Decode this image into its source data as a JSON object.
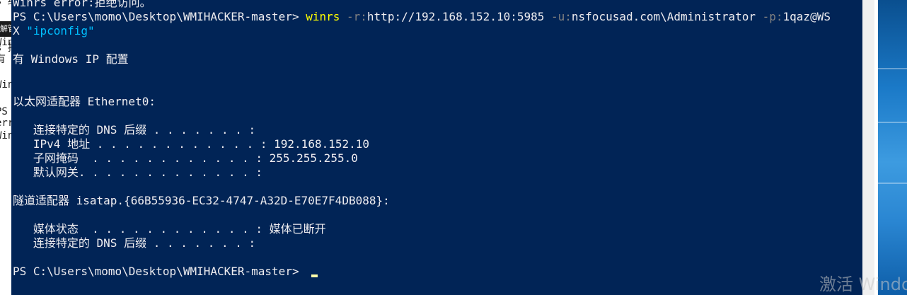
{
  "background_window": {
    "fragments": [
      "s 终",
      "Win",
      "s 拒",
      "有",
      "Win",
      "PS F",
      "err",
      "Win"
    ],
    "dark_tab_label": "解管"
  },
  "console": {
    "lines": [
      [
        {
          "t": "Winrs error:拒绝访问。",
          "c": ""
        }
      ],
      [
        {
          "t": "PS C:\\Users\\momo\\Desktop\\WMIHACKER-master> ",
          "c": ""
        },
        {
          "t": "winrs",
          "c": "cmd"
        },
        {
          "t": " -r:",
          "c": "param"
        },
        {
          "t": "http://192.168.152.10:5985",
          "c": ""
        },
        {
          "t": " -u:",
          "c": "param"
        },
        {
          "t": "nsfocusad.com\\Administrator",
          "c": ""
        },
        {
          "t": " -p:",
          "c": "param"
        },
        {
          "t": "1qaz@WS",
          "c": ""
        }
      ],
      [
        {
          "t": "X ",
          "c": ""
        },
        {
          "t": "\"ipconfig\"",
          "c": "str"
        }
      ],
      [
        {
          "t": "",
          "c": ""
        }
      ],
      [
        {
          "t": "有 Windows IP 配置",
          "c": ""
        }
      ],
      [
        {
          "t": "",
          "c": ""
        }
      ],
      [
        {
          "t": "",
          "c": ""
        }
      ],
      [
        {
          "t": "以太网适配器 Ethernet0:",
          "c": ""
        }
      ],
      [
        {
          "t": "",
          "c": ""
        }
      ],
      [
        {
          "t": "   连接特定的 DNS 后缀 . . . . . . . :",
          "c": ""
        }
      ],
      [
        {
          "t": "   IPv4 地址 . . . . . . . . . . . . : 192.168.152.10",
          "c": ""
        }
      ],
      [
        {
          "t": "   子网掩码  . . . . . . . . . . . . : 255.255.255.0",
          "c": ""
        }
      ],
      [
        {
          "t": "   默认网关. . . . . . . . . . . . . :",
          "c": ""
        }
      ],
      [
        {
          "t": "",
          "c": ""
        }
      ],
      [
        {
          "t": "隧道适配器 isatap.{66B55936-EC32-4747-A32D-E70E7F4DB088}:",
          "c": ""
        }
      ],
      [
        {
          "t": "",
          "c": ""
        }
      ],
      [
        {
          "t": "   媒体状态  . . . . . . . . . . . . : 媒体已断开",
          "c": ""
        }
      ],
      [
        {
          "t": "   连接特定的 DNS 后缀 . . . . . . . :",
          "c": ""
        }
      ],
      [
        {
          "t": "",
          "c": ""
        }
      ],
      [
        {
          "t": "PS C:\\Users\\momo\\Desktop\\WMIHACKER-master> ",
          "c": ""
        }
      ]
    ],
    "colors": {
      "background": "#012456",
      "foreground": "#eeedf0",
      "command": "#ffff00",
      "parameter": "#808080",
      "string": "#00bfff",
      "cursor": "#ffffaa"
    }
  },
  "watermark": {
    "text": "激活 Windo"
  }
}
